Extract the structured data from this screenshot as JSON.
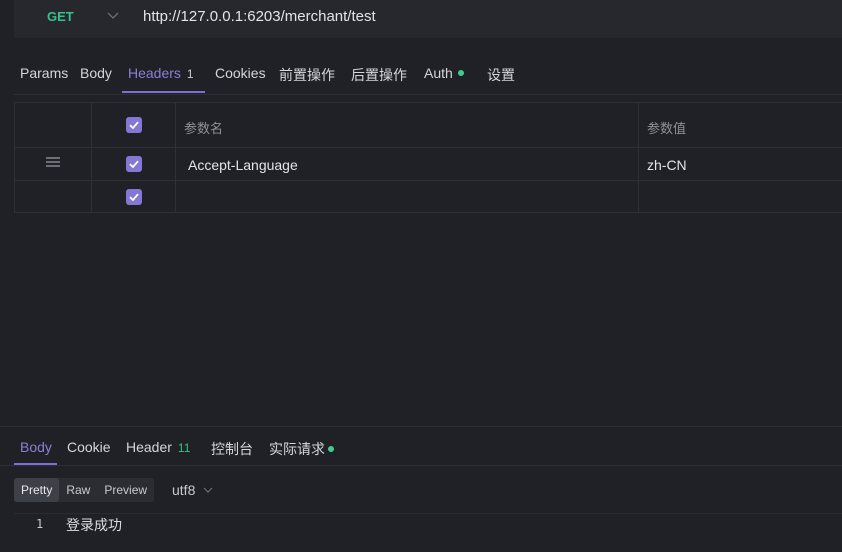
{
  "request": {
    "method": "GET",
    "url": "http://127.0.0.1:6203/merchant/test"
  },
  "tabs": {
    "params": "Params",
    "body": "Body",
    "headers": "Headers",
    "headers_count": "1",
    "cookies": "Cookies",
    "pre_action": "前置操作",
    "post_action": "后置操作",
    "auth": "Auth",
    "settings": "设置"
  },
  "headers_table": {
    "col_name": "参数名",
    "col_value": "参数值",
    "rows": [
      {
        "checked": true,
        "name": "Accept-Language",
        "value": "zh-CN"
      },
      {
        "checked": true,
        "name": "",
        "value": ""
      }
    ]
  },
  "response": {
    "tabs": {
      "body": "Body",
      "cookie": "Cookie",
      "header": "Header",
      "header_count": "11",
      "console": "控制台",
      "actual_request": "实际请求"
    },
    "view_modes": {
      "pretty": "Pretty",
      "raw": "Raw",
      "preview": "Preview"
    },
    "encoding": "utf8",
    "lines": [
      {
        "number": "1",
        "text": "登录成功"
      }
    ]
  },
  "colors": {
    "accent": "#7b6fd0",
    "method_get": "#36c18a",
    "status_dot": "#3ecf8e",
    "background": "#1f2126"
  }
}
